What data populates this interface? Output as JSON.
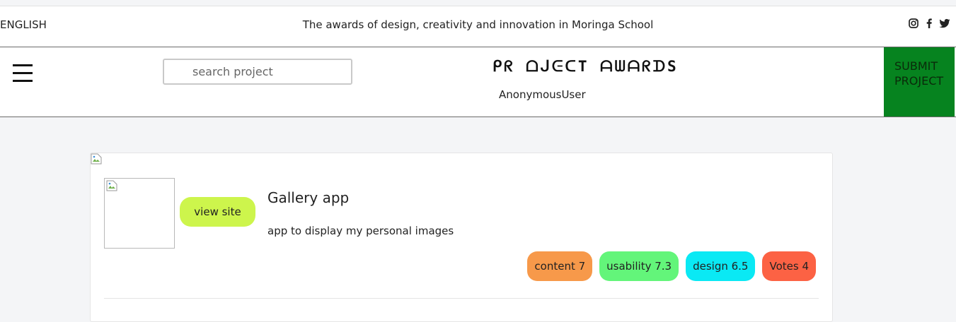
{
  "topbar": {
    "language": "ENGLISH",
    "tagline": "The awards of design, creativity and innovation in Moringa School",
    "social_icons": [
      "instagram-icon",
      "facebook-icon",
      "twitter-icon"
    ]
  },
  "navbar": {
    "menu_icon": "hamburger-menu-icon",
    "search_placeholder": "search project",
    "brand": "ᑭᖇ ᗝᒍᕮᑕT ᗩᗯᗩᖇᗪS",
    "username": "AnonymousUser",
    "submit_label": "SUBMIT PROJECT",
    "submit_color": "#06831f"
  },
  "project": {
    "title": "Gallery app",
    "description": "app to display my personal images",
    "view_site_label": "view site",
    "view_site_color": "#cdf54c",
    "ratings": [
      {
        "label": "content 7",
        "color": "#f7994a"
      },
      {
        "label": "usability 7.3",
        "color": "#63f57a"
      },
      {
        "label": "design 6.5",
        "color": "#0ae9f4"
      },
      {
        "label": "Votes 4",
        "color": "#fc6244"
      }
    ]
  }
}
